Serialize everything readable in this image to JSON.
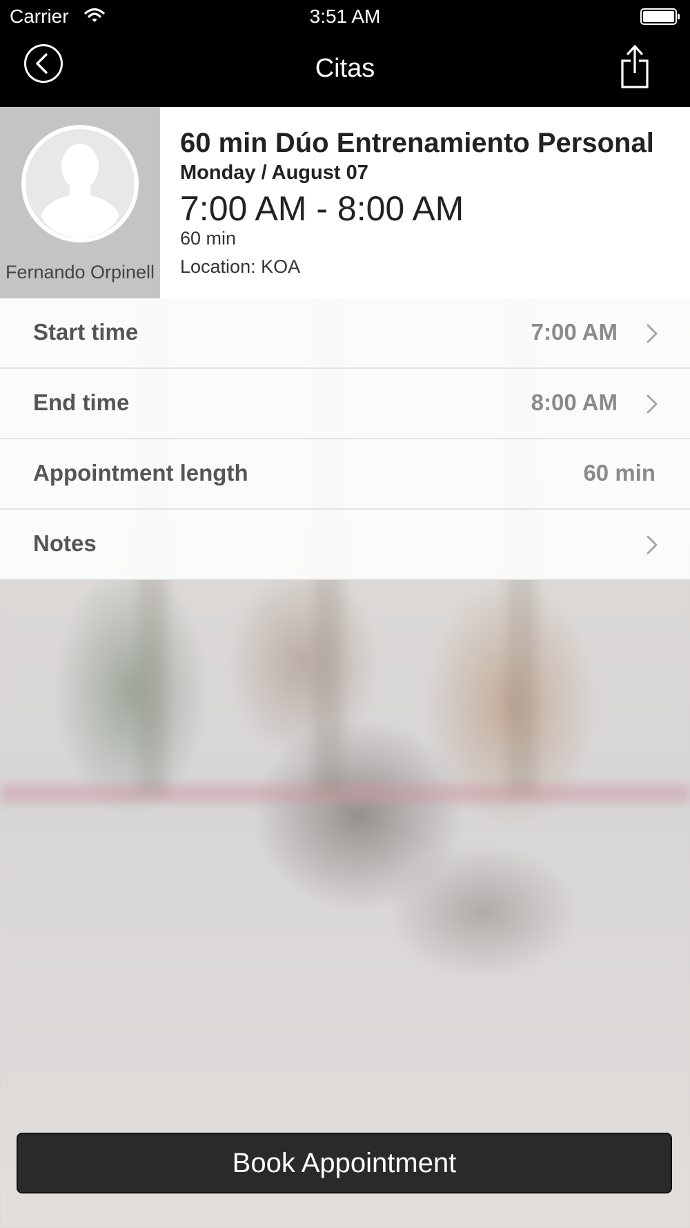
{
  "status_bar": {
    "carrier": "Carrier",
    "time": "3:51 AM",
    "wifi_icon": "wifi-icon",
    "battery_icon": "battery-icon"
  },
  "nav": {
    "title": "Citas",
    "back_icon": "chevron-left-circle-icon",
    "share_icon": "share-icon"
  },
  "appointment": {
    "staff_name": "Fernando Orpinell",
    "title": "60 min Dúo Entrenamiento Personal",
    "date": "Monday / August 07",
    "time_range": "7:00 AM - 8:00 AM",
    "duration": "60 min",
    "location": "Location: KOA"
  },
  "details": [
    {
      "label": "Start time",
      "value": "7:00 AM",
      "chevron": true
    },
    {
      "label": "End time",
      "value": "8:00 AM",
      "chevron": true
    },
    {
      "label": "Appointment length",
      "value": "60 min",
      "chevron": false
    },
    {
      "label": "Notes",
      "value": "",
      "chevron": true
    }
  ],
  "actions": {
    "book_label": "Book Appointment"
  },
  "colors": {
    "bar_background": "#000000",
    "button_background": "#2a2a2a",
    "staff_panel": "#c4c4c4"
  }
}
